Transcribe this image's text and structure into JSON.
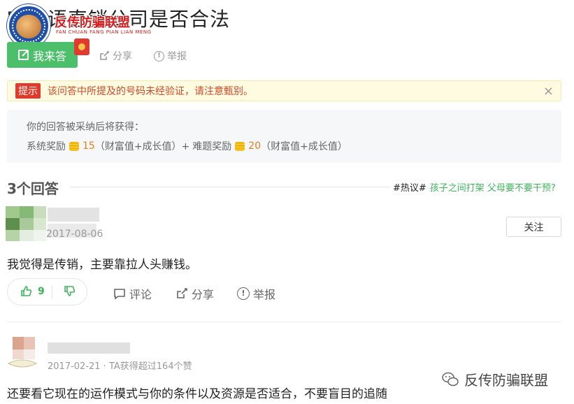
{
  "question": {
    "title": "宏兴语直销公司是否合法"
  },
  "watermark": {
    "brand": "反传防骗联盟",
    "sub": "FAN CHUAN FANG PIAN LIAN MENG",
    "bottom": "反传防骗联盟",
    "logo_text": "反传防骗联盟"
  },
  "actions": {
    "answer": "我来答",
    "share": "分享",
    "report": "举报"
  },
  "tip": {
    "tag": "提示",
    "text": "该问答中所提及的号码未经验证，请注意甄别。",
    "close": "×"
  },
  "reward": {
    "line1": "你的回答被采纳后将获得：",
    "system_label": "系统奖励",
    "system_value": "15",
    "system_unit": "（财富值+成长值）+",
    "hard_label": "难题奖励",
    "hard_value": "20",
    "hard_unit": "（财富值+成长值）"
  },
  "answers_header": {
    "title": "3个回答",
    "hot_tag": "#热议#",
    "hot_link": "孩子之间打架 父母要不要干预?"
  },
  "answers": [
    {
      "date": "2017-08-06",
      "follow": "关注",
      "text": "我觉得是传销，主要靠拉人头赚钱。",
      "likes": "9",
      "comment": "评论",
      "share": "分享",
      "report": "举报"
    },
    {
      "date": "2017-02-21 · TA获得超过164个赞",
      "text": "还要看它现在的运作模式与你的条件以及资源是否适合，不要盲目的追随"
    }
  ],
  "colors": {
    "green": "#4cbf6b",
    "tip_red": "#e1392b",
    "coin": "#f5b400",
    "orange": "#e47f1b"
  }
}
